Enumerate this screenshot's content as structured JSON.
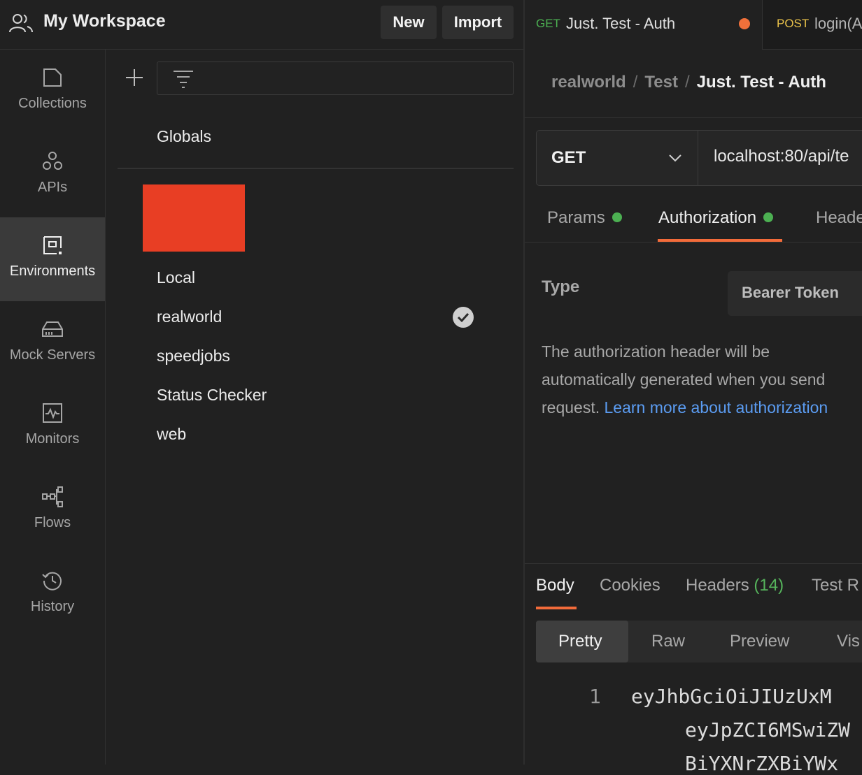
{
  "header": {
    "workspace_title": "My Workspace",
    "new_label": "New",
    "import_label": "Import"
  },
  "sidebar": {
    "items": [
      {
        "label": "Collections",
        "icon": "collections-icon"
      },
      {
        "label": "APIs",
        "icon": "apis-icon"
      },
      {
        "label": "Environments",
        "icon": "environments-icon",
        "active": true
      },
      {
        "label": "Mock Servers",
        "icon": "mock-servers-icon"
      },
      {
        "label": "Monitors",
        "icon": "monitors-icon"
      },
      {
        "label": "Flows",
        "icon": "flows-icon"
      },
      {
        "label": "History",
        "icon": "history-icon"
      }
    ]
  },
  "environments": {
    "globals_label": "Globals",
    "list": [
      "Local",
      "realworld",
      "speedjobs",
      "Status Checker",
      "web"
    ],
    "active": "realworld"
  },
  "tabs": [
    {
      "method": "GET",
      "title": "Just. Test - Auth",
      "unsaved": true
    },
    {
      "method": "POST",
      "title": "login(A"
    }
  ],
  "breadcrumb": {
    "items": [
      "realworld",
      "Test"
    ],
    "current": "Just. Test - Auth",
    "separator": "/"
  },
  "request": {
    "method": "GET",
    "url": "localhost:80/api/te"
  },
  "request_tabs": {
    "params": "Params",
    "authorization": "Authorization",
    "headers": "Heade"
  },
  "auth": {
    "type_label": "Type",
    "type_value": "Bearer Token",
    "help_line1": "The authorization header will be",
    "help_line2": "automatically generated when you send",
    "help_line3_prefix": "request. ",
    "help_link": "Learn more about authorization"
  },
  "response": {
    "tabs": {
      "body": "Body",
      "cookies": "Cookies",
      "headers": "Headers",
      "headers_count": "(14)",
      "tests": "Test R"
    },
    "formats": [
      "Pretty",
      "Raw",
      "Preview",
      "Vis"
    ],
    "line_number": "1",
    "code_lines": [
      "eyJhbGciOiJIUzUxM",
      "eyJpZCI6MSwiZW",
      "BiYXNrZXBiYWx"
    ]
  },
  "colors": {
    "get": "#4cb052",
    "post": "#e9c24a",
    "accent": "#f26b3a",
    "link": "#5b9cf2",
    "redaction": "#e83e24"
  }
}
